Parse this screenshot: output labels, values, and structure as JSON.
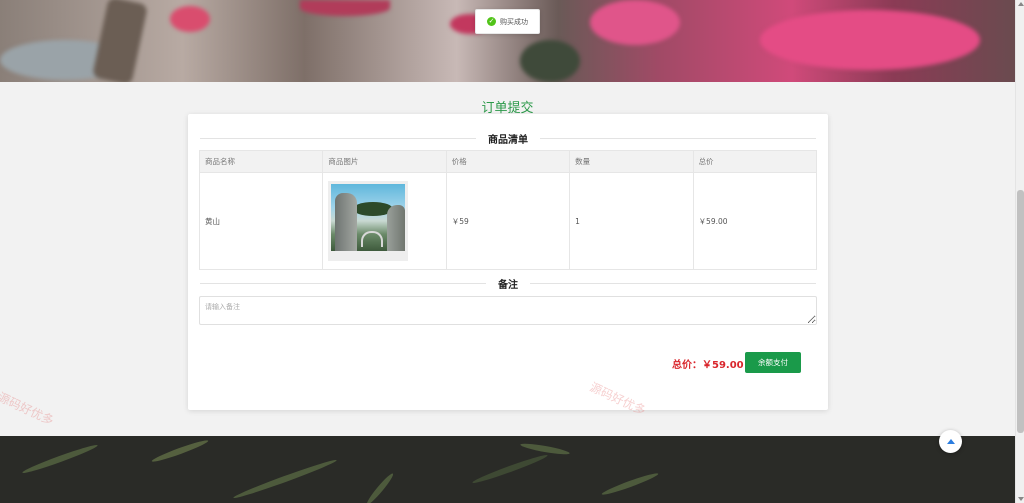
{
  "toast": {
    "text": "购买成功",
    "icon": "check-circle-icon"
  },
  "page": {
    "title": "订单提交"
  },
  "goods_section": {
    "title": "商品清单"
  },
  "table": {
    "headers": [
      "商品名称",
      "商品图片",
      "价格",
      "数量",
      "总价"
    ],
    "rows": [
      {
        "name": "黄山",
        "price": "￥59",
        "quantity": "1",
        "total": "￥59.00"
      }
    ]
  },
  "remark_section": {
    "title": "备注",
    "placeholder": "请输入备注"
  },
  "summary": {
    "total_label": "总价：￥59.00"
  },
  "actions": {
    "pay_label": "余额支付"
  },
  "watermark": {
    "text1": "源码好优多",
    "text2": "源码好优多"
  },
  "colors": {
    "accent": "#1a9a4a",
    "price": "#d9262c",
    "title": "#2c9a4a"
  }
}
